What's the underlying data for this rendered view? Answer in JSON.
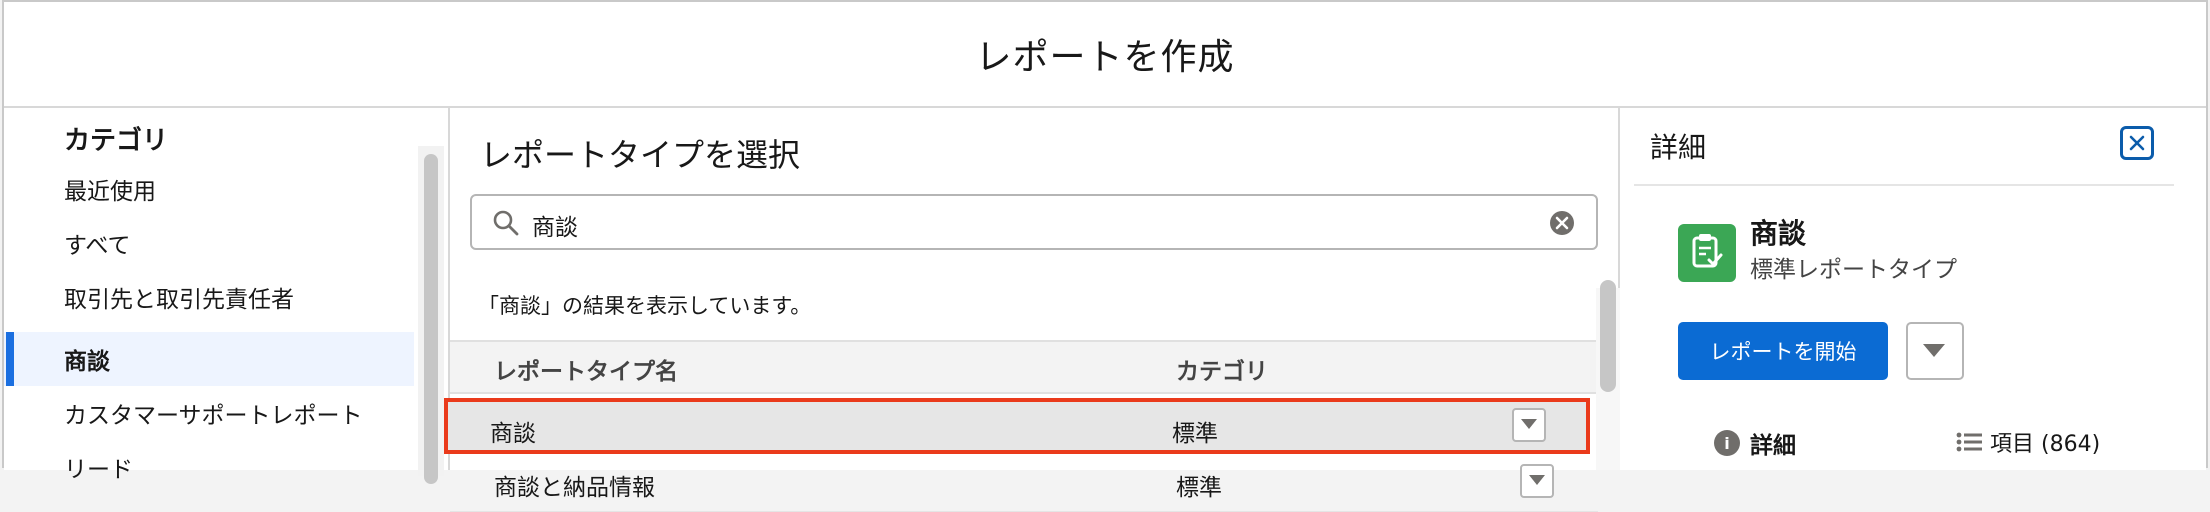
{
  "modal": {
    "title": "レポートを作成"
  },
  "category_pane": {
    "heading": "カテゴリ",
    "items": [
      {
        "label": "最近使用"
      },
      {
        "label": "すべて"
      },
      {
        "label": "取引先と取引先責任者"
      },
      {
        "label": "商談"
      },
      {
        "label": "カスタマーサポートレポート"
      },
      {
        "label": "リード"
      }
    ],
    "active_index": 3
  },
  "report_type_pane": {
    "title": "レポートタイプを選択",
    "search": {
      "value": "商談",
      "placeholder": ""
    },
    "result_message": "「商談」の結果を表示しています。",
    "columns": {
      "name": "レポートタイプ名",
      "category": "カテゴリ"
    },
    "rows": [
      {
        "name": "商談",
        "category": "標準",
        "selected": true
      },
      {
        "name": "商談と納品情報",
        "category": "標準",
        "selected": false
      }
    ]
  },
  "detail_pane": {
    "title": "詳細",
    "report_type_name": "商談",
    "report_type_kind": "標準レポートタイプ",
    "start_button": "レポートを開始",
    "tabs": {
      "details": "詳細",
      "fields": "項目 (864)"
    }
  },
  "colors": {
    "primary": "#0b6bd3",
    "selection_border": "#ea3a1b",
    "active_category_bg": "#eef4ff",
    "type_icon": "#3ba755"
  }
}
